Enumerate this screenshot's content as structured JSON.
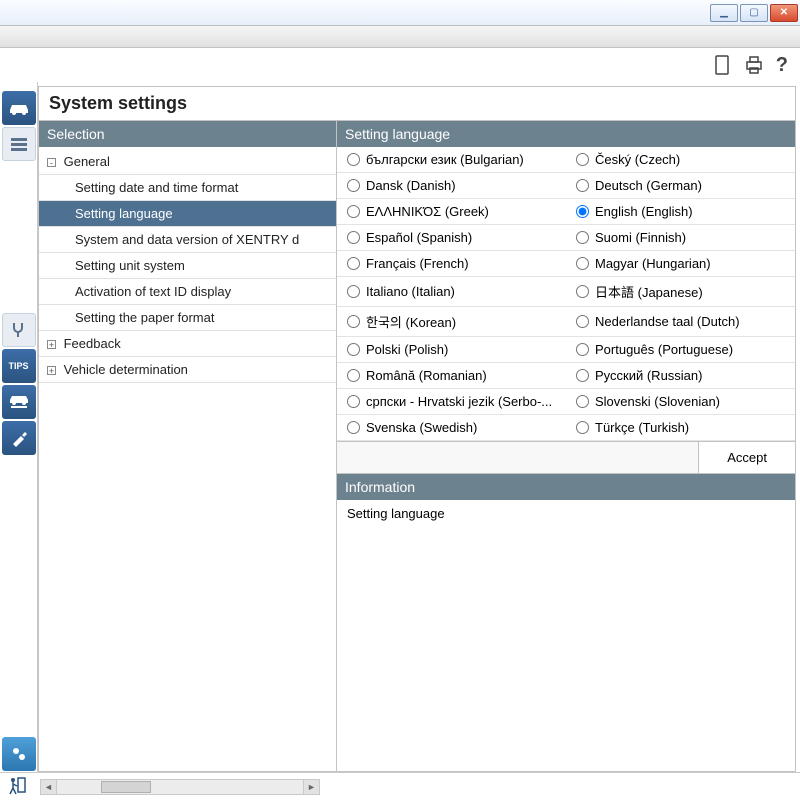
{
  "window": {
    "minimize_symbol": "▁",
    "maximize_symbol": "▢",
    "close_symbol": "✕"
  },
  "toolbar": {
    "help_label": "?"
  },
  "sidebar": {
    "tips_label": "TIPS"
  },
  "page": {
    "title": "System settings"
  },
  "selection": {
    "header": "Selection",
    "groups": [
      {
        "label": "General",
        "expanded": true,
        "children": [
          {
            "label": "Setting date and time format"
          },
          {
            "label": "Setting language",
            "selected": true
          },
          {
            "label": "System and data version of XENTRY d"
          },
          {
            "label": "Setting unit system"
          },
          {
            "label": "Activation of text ID display"
          },
          {
            "label": "Setting the paper format"
          }
        ]
      },
      {
        "label": "Feedback",
        "expanded": false
      },
      {
        "label": "Vehicle determination",
        "expanded": false
      }
    ]
  },
  "language_panel": {
    "header": "Setting language",
    "selected": "English (English)",
    "options": [
      "български език (Bulgarian)",
      "Český (Czech)",
      "Dansk (Danish)",
      "Deutsch (German)",
      "ΕΛΛΗΝΙΚΌΣ (Greek)",
      "English (English)",
      "Español (Spanish)",
      "Suomi (Finnish)",
      "Français (French)",
      "Magyar (Hungarian)",
      "Italiano (Italian)",
      "日本語 (Japanese)",
      "한국의 (Korean)",
      "Nederlandse taal (Dutch)",
      "Polski (Polish)",
      "Português (Portuguese)",
      "Română (Romanian)",
      "Русский (Russian)",
      "српски - Hrvatski jezik (Serbo-...",
      "Slovenski (Slovenian)",
      "Svenska (Swedish)",
      "Türkçe (Turkish)"
    ],
    "accept_label": "Accept"
  },
  "info_panel": {
    "header": "Information",
    "body": "Setting language"
  }
}
